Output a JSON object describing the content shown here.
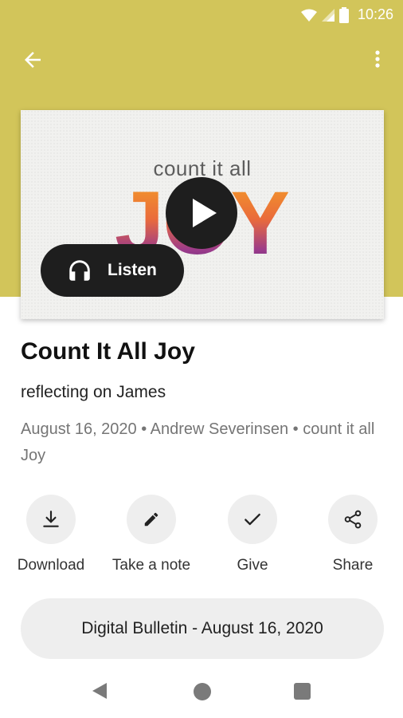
{
  "status_bar": {
    "time": "10:26",
    "icons": [
      "wifi-icon",
      "signal-icon",
      "battery-icon"
    ]
  },
  "app_bar": {
    "back_icon": "arrow-left-icon",
    "more_icon": "more-vert-icon"
  },
  "colors": {
    "header_bg": "#d2c55a",
    "dark_button": "#1e1e1e",
    "chip_bg": "#eeeeee"
  },
  "artwork": {
    "line1": "count it all",
    "line2": "JOY"
  },
  "listen_label": "Listen",
  "sermon": {
    "title": "Count It All Joy",
    "subtitle": "reflecting on James",
    "meta": "August 16, 2020 • Andrew Severinsen • count it all Joy"
  },
  "actions": [
    {
      "label": "Download",
      "icon": "download-icon"
    },
    {
      "label": "Take a note",
      "icon": "pencil-icon"
    },
    {
      "label": "Give",
      "icon": "check-icon"
    },
    {
      "label": "Share",
      "icon": "share-icon"
    }
  ],
  "bulletin_label": "Digital Bulletin - August 16, 2020",
  "nav": [
    "back-triangle-icon",
    "home-circle-icon",
    "recents-square-icon"
  ]
}
